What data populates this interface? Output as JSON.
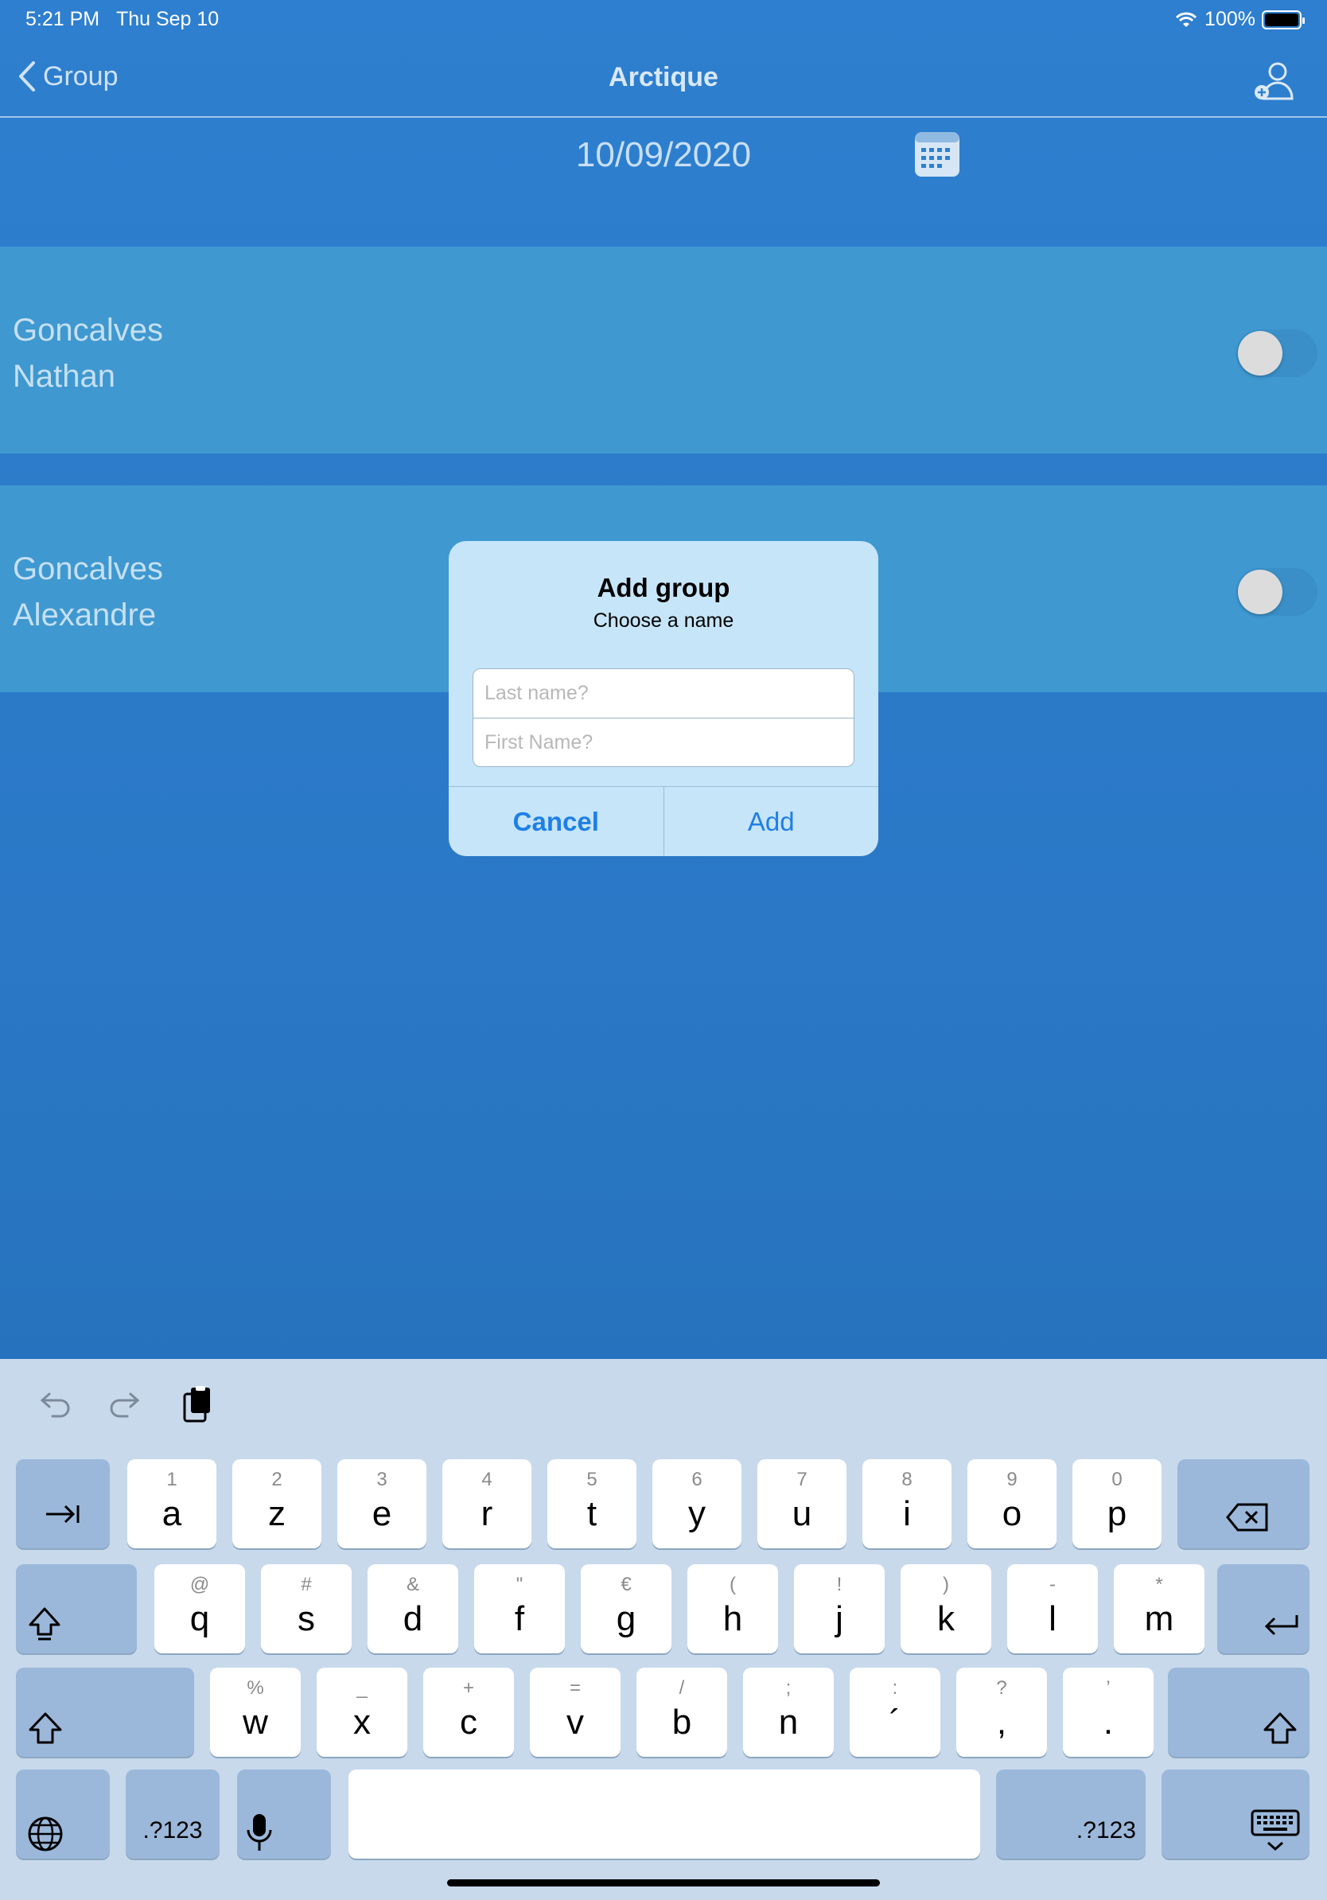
{
  "status": {
    "time": "5:21 PM",
    "date": "Thu Sep 10",
    "battery": "100%"
  },
  "nav": {
    "back_label": "Group",
    "title": "Arctique"
  },
  "date": "10/09/2020",
  "people": [
    {
      "last": "Goncalves",
      "first": "Nathan",
      "on": false
    },
    {
      "last": "Goncalves",
      "first": "Alexandre",
      "on": false
    }
  ],
  "dialog": {
    "title": "Add group",
    "message": "Choose a name",
    "last_placeholder": "Last name?",
    "first_placeholder": "First Name?",
    "cancel": "Cancel",
    "add": "Add"
  },
  "keyboard": {
    "row1": [
      {
        "sec": "1",
        "pri": "a"
      },
      {
        "sec": "2",
        "pri": "z"
      },
      {
        "sec": "3",
        "pri": "e"
      },
      {
        "sec": "4",
        "pri": "r"
      },
      {
        "sec": "5",
        "pri": "t"
      },
      {
        "sec": "6",
        "pri": "y"
      },
      {
        "sec": "7",
        "pri": "u"
      },
      {
        "sec": "8",
        "pri": "i"
      },
      {
        "sec": "9",
        "pri": "o"
      },
      {
        "sec": "0",
        "pri": "p"
      }
    ],
    "row2": [
      {
        "sec": "@",
        "pri": "q"
      },
      {
        "sec": "#",
        "pri": "s"
      },
      {
        "sec": "&",
        "pri": "d"
      },
      {
        "sec": "\"",
        "pri": "f"
      },
      {
        "sec": "€",
        "pri": "g"
      },
      {
        "sec": "(",
        "pri": "h"
      },
      {
        "sec": "!",
        "pri": "j"
      },
      {
        "sec": ")",
        "pri": "k"
      },
      {
        "sec": "-",
        "pri": "l"
      },
      {
        "sec": "*",
        "pri": "m"
      }
    ],
    "row3": [
      {
        "sec": "%",
        "pri": "w"
      },
      {
        "sec": "_",
        "pri": "x"
      },
      {
        "sec": "+",
        "pri": "c"
      },
      {
        "sec": "=",
        "pri": "v"
      },
      {
        "sec": "/",
        "pri": "b"
      },
      {
        "sec": ";",
        "pri": "n"
      },
      {
        "sec": ":",
        "pri": "´"
      },
      {
        "sec": "?",
        "pri": ","
      },
      {
        "sec": "’",
        "pri": "."
      }
    ],
    "numbers_label": ".?123"
  }
}
